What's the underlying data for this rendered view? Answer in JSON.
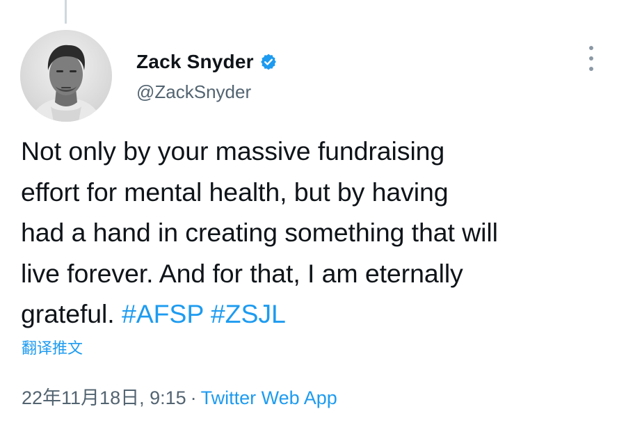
{
  "author": {
    "display_name": "Zack Snyder",
    "handle": "@ZackSnyder",
    "verified": true,
    "avatar": "profile-photo"
  },
  "tweet": {
    "lines": [
      {
        "text": "Not only by your massive fundraising"
      },
      {
        "text": "effort for mental health, but by having"
      },
      {
        "text": "had a hand in creating something that will"
      },
      {
        "text": "live forever. And for that, I am eternally"
      },
      {
        "text": "grateful.",
        "hashtags": [
          "#AFSP",
          "#ZSJL"
        ]
      }
    ]
  },
  "translate_label": "翻译推文",
  "meta": {
    "timestamp": "22年11月18日, 9:15",
    "separator": "·",
    "source": "Twitter Web App"
  },
  "icons": {
    "verified": "verified-badge-icon",
    "more": "more-options-icon"
  },
  "colors": {
    "accent": "#1d9bf0",
    "text": "#0f1419",
    "secondary": "#536471"
  }
}
